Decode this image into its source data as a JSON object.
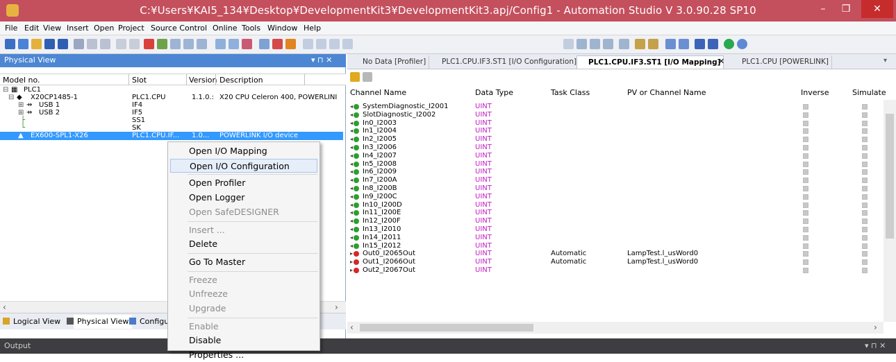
{
  "window": {
    "title": "C:¥Users¥KAI5_134¥Desktop¥DevelopmentKit3¥DevelopmentKit3.apj/Config1 - Automation Studio V 3.0.90.28 SP10",
    "minimize": "–",
    "maximize": "❐",
    "close": "✕"
  },
  "menu": [
    "File",
    "Edit",
    "View",
    "Insert",
    "Open",
    "Project",
    "Source Control",
    "Online",
    "Tools",
    "Window",
    "Help"
  ],
  "physical_view": {
    "title": "Physical View",
    "controls": "▾ ⊓ ✕",
    "columns": [
      "Model no.",
      "Slot",
      "Version",
      "Description"
    ],
    "rows": [
      {
        "model": "PLC1",
        "slot": "",
        "version": "",
        "desc": ""
      },
      {
        "model": "X20CP1485-1",
        "slot": "PLC1.CPU",
        "version": "1.1.0.:",
        "desc": "X20 CPU Celeron 400, POWERLINI"
      },
      {
        "model": "USB 1",
        "slot": "IF4",
        "version": "",
        "desc": ""
      },
      {
        "model": "USB 2",
        "slot": "IF5",
        "version": "",
        "desc": ""
      },
      {
        "model": "",
        "slot": "SS1",
        "version": "",
        "desc": ""
      },
      {
        "model": "",
        "slot": "SK",
        "version": "",
        "desc": ""
      },
      {
        "model": "EX600-SPL1-X26",
        "slot": "PLC1.CPU.IF...",
        "version": "1.0...",
        "desc": "POWERLINK I/O device"
      }
    ],
    "tabs": [
      "Logical View",
      "Physical View",
      "Configu"
    ]
  },
  "doc_tabs": [
    {
      "label": "No Data [Profiler]"
    },
    {
      "label": "PLC1.CPU.IF3.ST1 [I/O Configuration]"
    },
    {
      "label": "PLC1.CPU.IF3.ST1 [I/O Mapping]",
      "close": "✕"
    },
    {
      "label": "PLC1.CPU [POWERLINK]"
    }
  ],
  "mapping": {
    "columns": [
      "Channel Name",
      "Data Type",
      "Task Class",
      "PV or Channel Name",
      "Inverse",
      "Simulate"
    ],
    "rows": [
      {
        "dir": "in",
        "name": "SystemDiagnostic_I2001",
        "type": "UINT",
        "task": "",
        "pv": ""
      },
      {
        "dir": "in",
        "name": "SlotDiagnostic_I2002",
        "type": "UINT",
        "task": "",
        "pv": ""
      },
      {
        "dir": "in",
        "name": "In0_I2003",
        "type": "UINT",
        "task": "",
        "pv": ""
      },
      {
        "dir": "in",
        "name": "In1_I2004",
        "type": "UINT",
        "task": "",
        "pv": ""
      },
      {
        "dir": "in",
        "name": "In2_I2005",
        "type": "UINT",
        "task": "",
        "pv": ""
      },
      {
        "dir": "in",
        "name": "In3_I2006",
        "type": "UINT",
        "task": "",
        "pv": ""
      },
      {
        "dir": "in",
        "name": "In4_I2007",
        "type": "UINT",
        "task": "",
        "pv": ""
      },
      {
        "dir": "in",
        "name": "In5_I2008",
        "type": "UINT",
        "task": "",
        "pv": ""
      },
      {
        "dir": "in",
        "name": "In6_I2009",
        "type": "UINT",
        "task": "",
        "pv": ""
      },
      {
        "dir": "in",
        "name": "In7_I200A",
        "type": "UINT",
        "task": "",
        "pv": ""
      },
      {
        "dir": "in",
        "name": "In8_I200B",
        "type": "UINT",
        "task": "",
        "pv": ""
      },
      {
        "dir": "in",
        "name": "In9_I200C",
        "type": "UINT",
        "task": "",
        "pv": ""
      },
      {
        "dir": "in",
        "name": "In10_I200D",
        "type": "UINT",
        "task": "",
        "pv": ""
      },
      {
        "dir": "in",
        "name": "In11_I200E",
        "type": "UINT",
        "task": "",
        "pv": ""
      },
      {
        "dir": "in",
        "name": "In12_I200F",
        "type": "UINT",
        "task": "",
        "pv": ""
      },
      {
        "dir": "in",
        "name": "In13_I2010",
        "type": "UINT",
        "task": "",
        "pv": ""
      },
      {
        "dir": "in",
        "name": "In14_I2011",
        "type": "UINT",
        "task": "",
        "pv": ""
      },
      {
        "dir": "in",
        "name": "In15_I2012",
        "type": "UINT",
        "task": "",
        "pv": ""
      },
      {
        "dir": "out",
        "name": "Out0_I2065Out",
        "type": "UINT",
        "task": "Automatic",
        "pv": "LampTest.l_usWord0"
      },
      {
        "dir": "out",
        "name": "Out1_I2066Out",
        "type": "UINT",
        "task": "Automatic",
        "pv": "LampTest.l_usWord0"
      },
      {
        "dir": "out",
        "name": "Out2_I2067Out",
        "type": "UINT",
        "task": "",
        "pv": ""
      }
    ]
  },
  "context_menu": [
    {
      "label": "Open I/O Mapping",
      "enabled": true
    },
    {
      "label": "Open I/O Configuration",
      "enabled": true,
      "highlighted": true
    },
    {
      "sep": true
    },
    {
      "label": "Open Profiler",
      "enabled": true
    },
    {
      "label": "Open Logger",
      "enabled": true
    },
    {
      "label": "Open SafeDESIGNER",
      "enabled": false
    },
    {
      "sep": true
    },
    {
      "label": "Insert ...",
      "enabled": false
    },
    {
      "label": "Delete",
      "enabled": true
    },
    {
      "sep": true
    },
    {
      "label": "Go To Master",
      "enabled": true
    },
    {
      "sep": true
    },
    {
      "label": "Freeze",
      "enabled": false
    },
    {
      "label": "Unfreeze",
      "enabled": false
    },
    {
      "label": "Upgrade",
      "enabled": false
    },
    {
      "sep": true
    },
    {
      "label": "Enable",
      "enabled": false
    },
    {
      "label": "Disable",
      "enabled": true
    },
    {
      "label": "Properties ...",
      "enabled": true
    }
  ],
  "output": {
    "title": "Output",
    "controls": "▾ ⊓ ✕"
  }
}
